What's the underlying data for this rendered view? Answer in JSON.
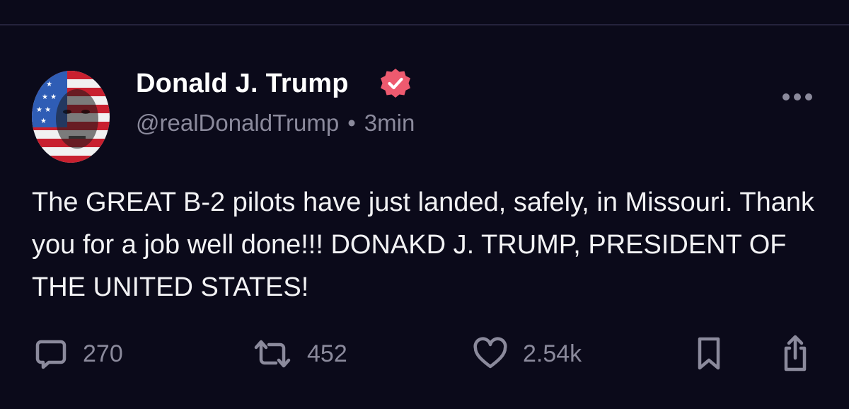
{
  "post": {
    "author": {
      "display_name": "Donald J. Trump",
      "handle": "@realDonaldTrump",
      "verified": true
    },
    "separator": "•",
    "timestamp": "3min",
    "text": "The GREAT B-2 pilots have just landed, safely, in Missouri. Thank you for a job well done!!! DONAKD J. TRUMP, PRESIDENT OF THE UNITED STATES!",
    "stats": {
      "replies": "270",
      "reposts": "452",
      "likes": "2.54k"
    }
  },
  "icons": {
    "more": "more-horizontal-icon",
    "reply": "comment-bubble-icon",
    "repost": "repost-arrows-icon",
    "like": "heart-icon",
    "bookmark": "bookmark-icon",
    "share": "share-upload-icon",
    "verified": "verified-badge-icon"
  },
  "colors": {
    "background": "#0b0a1a",
    "muted_text": "#8b8a9c",
    "verified_badge": "#ee5a6f",
    "icon_stroke": "#8b8a9c"
  }
}
